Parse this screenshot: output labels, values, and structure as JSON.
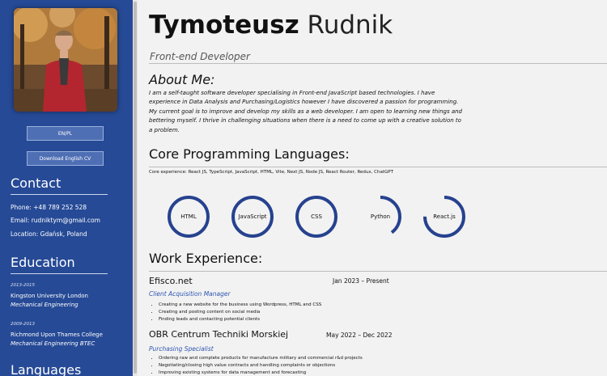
{
  "profile": {
    "first_name": "Tymoteusz",
    "last_name": "Rudnik",
    "role": "Front-end Developer"
  },
  "sidebar": {
    "language_button": "EN/PL",
    "cv_button": "Download English CV",
    "contact": {
      "heading": "Contact",
      "phone": "Phone: +48 789 252 528",
      "email": "Email: rudniktym@gmail.com",
      "location": "Location: Gdańsk, Poland"
    },
    "education": {
      "heading": "Education",
      "items": [
        {
          "dates": "2013-2015",
          "school": "Kingston University London",
          "course": "Mechanical Engineering"
        },
        {
          "dates": "2009-2013",
          "school": "Richmond Upon Thames College",
          "course": "Mechanical Engineering BTEC"
        }
      ]
    },
    "languages_heading": "Languages"
  },
  "about": {
    "heading": "About Me:",
    "text": "I am a self-taught software developer specialising in Front-end JavaScript based technologies. I have experience in Data Analysis and Purchasing/Logistics however I have discovered a passion for programming. My current goal is to improve and develop my skills as a web developer. I am open to learning new things and bettering myself. I thrive in challenging situations when there is a need to come up with a creative solution to a problem."
  },
  "core": {
    "heading": "Core Programming Languages:",
    "experience": "Core experience: React JS, TypeScript, JavaScript, HTML, Vite, Next JS, Node JS, React Router, Redux, ChatGPT",
    "skills": [
      {
        "name": "HTML",
        "level": 1.0
      },
      {
        "name": "JavaScript",
        "level": 1.0
      },
      {
        "name": "CSS",
        "level": 1.0
      },
      {
        "name": "Python",
        "level": 0.4
      },
      {
        "name": "React.js",
        "level": 0.75
      }
    ]
  },
  "work": {
    "heading": "Work Experience:",
    "jobs": [
      {
        "company": "Efisco.net",
        "period": "Jan 2023 – Present",
        "title": "Client Acquisition Manager",
        "duties": [
          "Creating a new website for the business using Wordpress, HTML and CSS",
          "Creating and posting content on social media",
          "Finding leads and contacting potential clients"
        ]
      },
      {
        "company": "OBR Centrum Techniki Morskiej",
        "period": "May 2022 – Dec 2022",
        "title": "Purchasing Specialist",
        "duties": [
          "Ordering raw and complete products for manufacture military and commercial r&d projects",
          "Negotiating/closing high value contracts and handling complaints or objections",
          "Improving existing systems for data management and forecasting"
        ]
      }
    ]
  },
  "colors": {
    "sidebar": "#264a96",
    "accent": "#2f56b0",
    "ring": "#26428f"
  }
}
